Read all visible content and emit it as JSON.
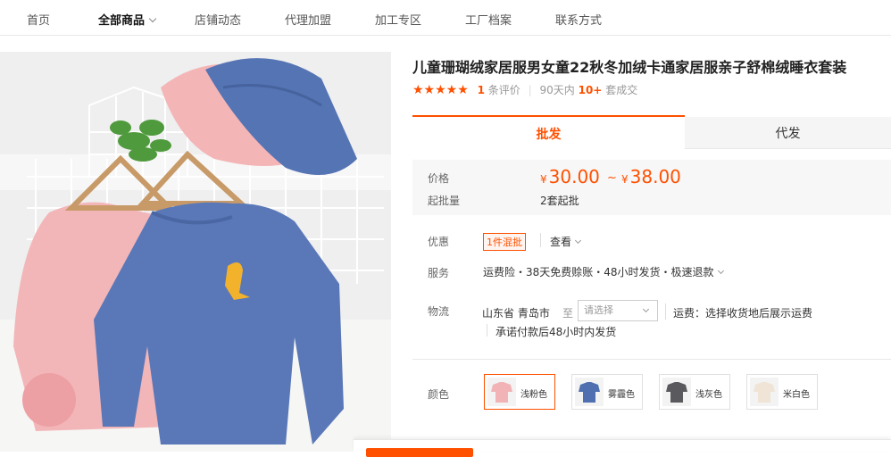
{
  "nav": {
    "items": [
      {
        "label": "首页"
      },
      {
        "label": "全部商品"
      },
      {
        "label": "店铺动态"
      },
      {
        "label": "代理加盟"
      },
      {
        "label": "加工专区"
      },
      {
        "label": "工厂档案"
      },
      {
        "label": "联系方式"
      }
    ]
  },
  "product": {
    "title": "儿童珊瑚绒家居服男女童22秋冬加绒卡通家居服亲子舒棉绒睡衣套装",
    "stars": "★★★★★",
    "review_count": "1",
    "review_suffix": "条评价",
    "period_prefix": "90天内",
    "sold_count": "10+",
    "sold_suffix": "套成交"
  },
  "tabs": {
    "wholesale": "批发",
    "dropship": "代发"
  },
  "price": {
    "label": "价格",
    "currency": "¥",
    "min": "30.00",
    "tilde": "~",
    "max": "38.00",
    "moq_label": "起批量",
    "moq_value": "2套起批"
  },
  "offers": {
    "label": "优惠",
    "tag": "1件混批",
    "view": "查看"
  },
  "service": {
    "label": "服务",
    "text": "运费险・38天免费赊账・48小时发货・极速退款"
  },
  "logistics": {
    "label": "物流",
    "origin": "山东省 青岛市",
    "to": "至",
    "select_placeholder": "请选择",
    "fee_text": "运费：选择收货地后展示运费",
    "promise": "承诺付款后48小时内发货"
  },
  "color": {
    "label": "颜色",
    "options": [
      {
        "label": "浅粉色",
        "color": "#f2b3b6"
      },
      {
        "label": "雾霾色",
        "color": "#4f6fb0"
      },
      {
        "label": "浅灰色",
        "color": "#5a5a5e"
      },
      {
        "label": "米白色",
        "color": "#efe4d6"
      }
    ]
  },
  "colors": {
    "accent": "#ff5000"
  }
}
